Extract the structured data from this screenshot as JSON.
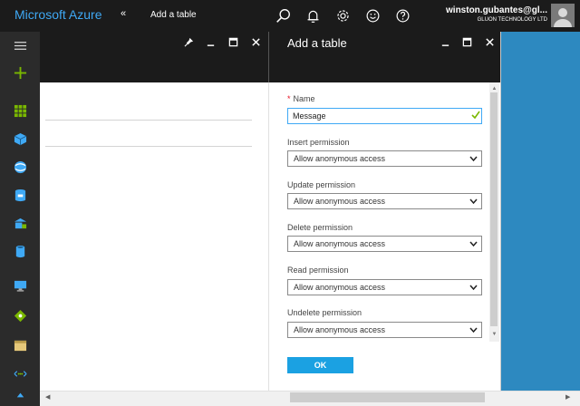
{
  "topbar": {
    "brand": "Microsoft Azure",
    "collapse_glyph": "«",
    "breadcrumb": "Add a table",
    "icons": [
      "search-icon",
      "notifications-icon",
      "settings-icon",
      "feedback-icon",
      "help-icon"
    ],
    "user_name": "winston.gubantes@gl...",
    "user_org": "GLUON TECHNOLOGY LTD"
  },
  "sidebar": {
    "items": [
      "hamburger-icon",
      "new-icon",
      "dashboard-icon",
      "resource-icon",
      "web-icon",
      "sql-icon",
      "storage-icon",
      "database-icon",
      "virtual-machine-icon",
      "marketplace-icon",
      "browser-icon",
      "network-icon",
      "more-icon"
    ]
  },
  "blade2": {
    "title": "Add a table",
    "name_label": "Name",
    "required_marker": "*",
    "name_value": "Message",
    "fields": [
      {
        "label": "Insert permission",
        "value": "Allow anonymous access"
      },
      {
        "label": "Update permission",
        "value": "Allow anonymous access"
      },
      {
        "label": "Delete permission",
        "value": "Allow anonymous access"
      },
      {
        "label": "Read permission",
        "value": "Allow anonymous access"
      },
      {
        "label": "Undelete permission",
        "value": "Allow anonymous access"
      }
    ],
    "ok_label": "OK"
  },
  "colors": {
    "topbar": "#1b1b1b",
    "brand": "#3fa9f5",
    "accent": "#1ba1e2",
    "sidebar": "#2b2b2b",
    "valid_check": "#7ab800",
    "required": "#e81123",
    "background_right": "#2d89c0"
  }
}
